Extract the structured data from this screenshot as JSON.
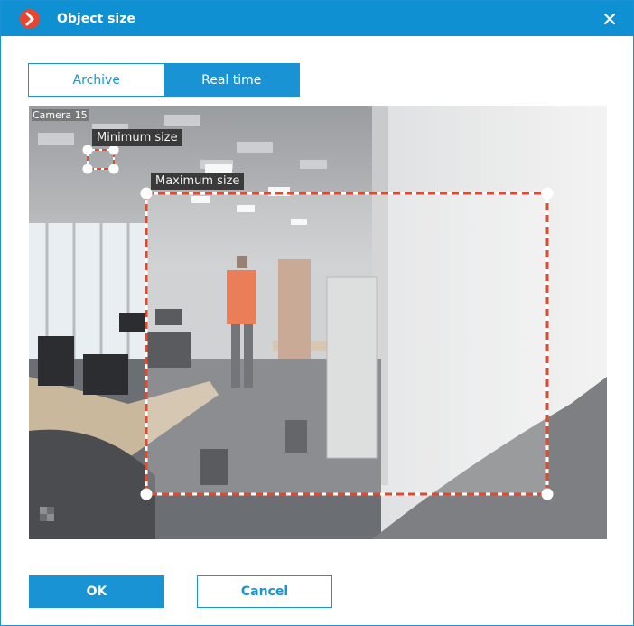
{
  "window": {
    "title": "Object size",
    "logo_icon": "chevron-right-icon",
    "close_icon": "close-icon",
    "accent_color": "#1a93d4",
    "logo_color": "#e8452c"
  },
  "tabs": [
    {
      "label": "Archive",
      "active": false
    },
    {
      "label": "Real time",
      "active": true
    }
  ],
  "video": {
    "camera_label": "Camera 15",
    "minimum_size_label": "Minimum size",
    "maximum_size_label": "Maximum size",
    "frame_color": "#e04a2f"
  },
  "buttons": {
    "ok": "OK",
    "cancel": "Cancel"
  }
}
